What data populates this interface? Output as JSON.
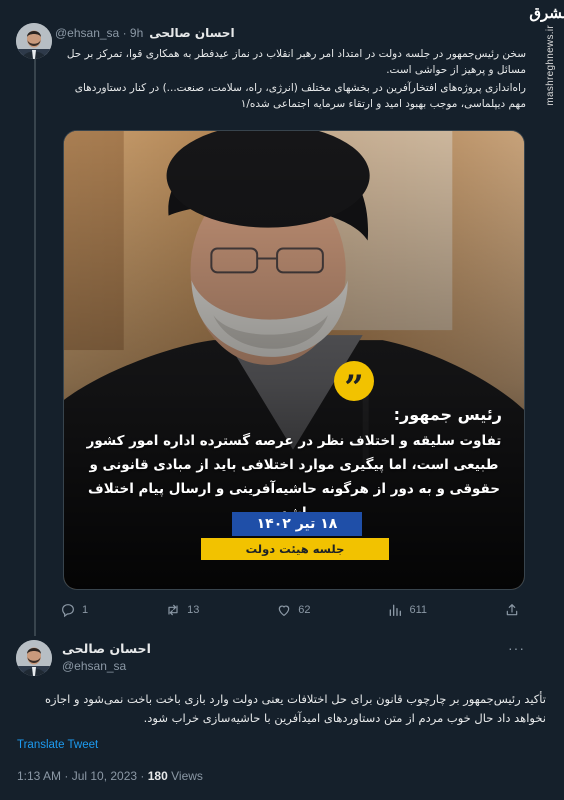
{
  "watermark": {
    "logo_text": "مشرق",
    "url": "mashreghnews.ir"
  },
  "tweet1": {
    "author_name": "احسان صالحی",
    "author_handle": "@ehsan_sa",
    "time_ago": "· 9h",
    "paragraph1": "سخن رئیس‌جمهور در جلسه دولت در امتداد امر رهبر انقلاب در نماز عیدفطر به همکاری قوا، تمرکز بر حل مسائل و پرهیز از حواشی است.",
    "paragraph2": "راه‌اندازی پروژه‌های افتخارآفرین در بخشهای مختلف (انرژی، راه، سلامت، صنعت...) در کنار دستاوردهای مهم دیپلماسی، موجب بهبود امید و ارتقاء سرمایه اجتماعی شده/۱",
    "media": {
      "quote_icon": "quote-icon",
      "quote_mark": "”",
      "title": "رئیس جمهور:",
      "quote": "تفاوت سلیقه و اختلاف نظر در عرصه گسترده اداره امور کشور طبیعی است، اما پیگیری موارد اختلافی باید از مبادی قانونی و حقوقی و به دور از هرگونه حاشیه‌آفرینی و ارسال پیام اختلاف باشد.",
      "date": "۱۸ تیر ۱۴۰۲",
      "session": "جلسه هیئت دولت"
    },
    "actions": {
      "reply_count": "1",
      "retweet_count": "13",
      "like_count": "62",
      "views_count": "611"
    }
  },
  "tweet2": {
    "author_name": "احسان صالحی",
    "author_handle": "@ehsan_sa",
    "more_label": "···",
    "text": "تأکید رئیس‌جمهور بر چارچوب قانون برای حل اختلافات یعنی دولت وارد بازی باخت باخت نمی‌شود و اجازه نخواهد داد حال خوب مردم از متن دستاوردهای امیدآفرین با حاشیه‌سازی خراب شود.",
    "translate_label": "Translate Tweet",
    "timestamp": "1:13 AM · Jul 10, 2023 · ",
    "views_number": "180",
    "views_label": " Views"
  },
  "colors": {
    "background": "#15202b",
    "text_primary": "#e7e9ea",
    "text_secondary": "#8b98a5",
    "link": "#1d9bf0",
    "accent_yellow": "#f2c200",
    "accent_blue": "#1f4fa8"
  }
}
